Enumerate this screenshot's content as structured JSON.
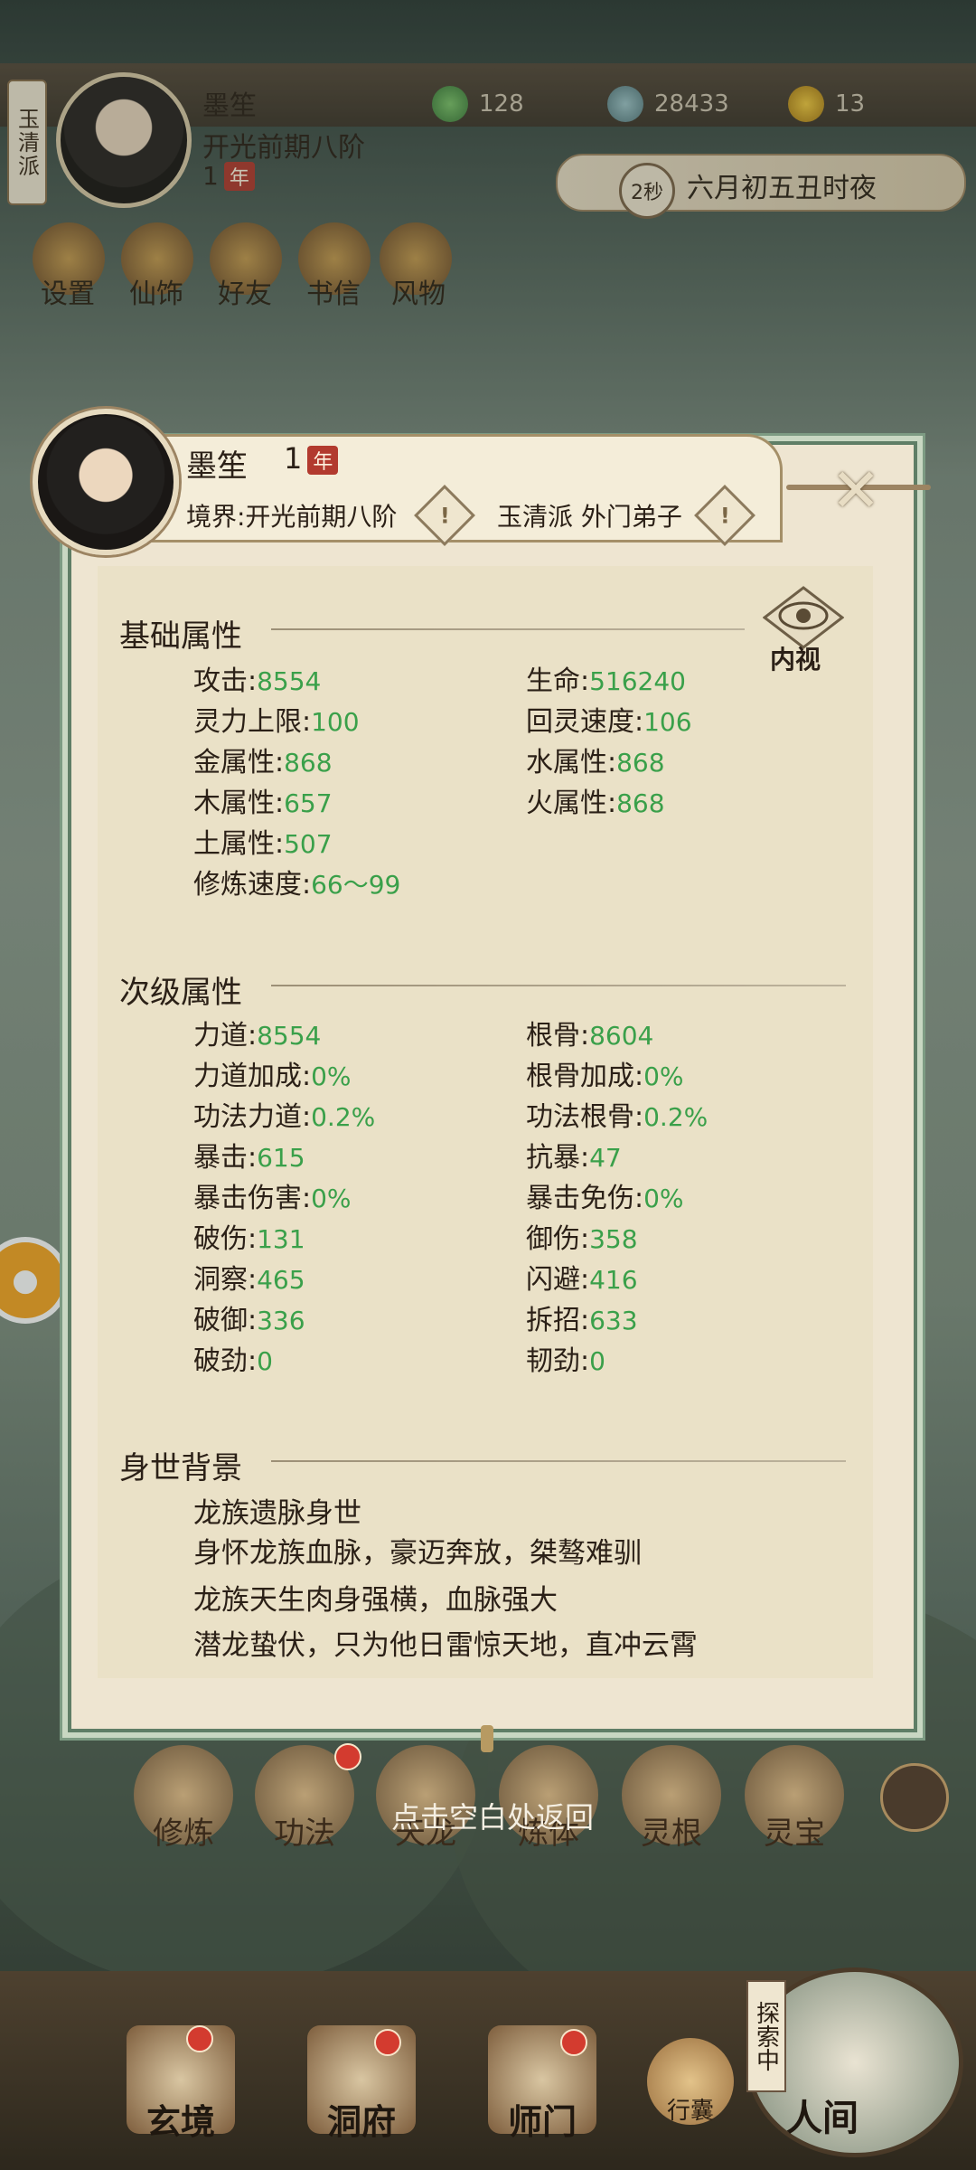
{
  "top": {
    "sect_tag": "玉清派",
    "player_name": "墨笙",
    "realm": "开光前期八阶",
    "age": "1",
    "age_badge": "年",
    "resources": [
      {
        "icon": "jade-leaf-icon",
        "value": "128"
      },
      {
        "icon": "coin-icon",
        "value": "28433"
      },
      {
        "icon": "gold-ingot-icon",
        "value": "13"
      }
    ],
    "time_seconds": "2秒",
    "time_text": "六月初五丑时夜",
    "menu": [
      {
        "label": "设置",
        "icon": "settings-icon"
      },
      {
        "label": "仙饰",
        "icon": "costume-icon"
      },
      {
        "label": "好友",
        "icon": "friends-icon"
      },
      {
        "label": "书信",
        "icon": "letter-icon"
      },
      {
        "label": "风物",
        "icon": "scenery-icon"
      }
    ]
  },
  "panel": {
    "name": "墨笙",
    "age": "1",
    "age_badge": "年",
    "realm_line": "境界:开光前期八阶",
    "sect_line": "玉清派 外门弟子",
    "inner_view_label": "内视",
    "basic": {
      "title": "基础属性",
      "left": [
        {
          "label": "攻击",
          "value": "8554"
        },
        {
          "label": "灵力上限",
          "value": "100"
        },
        {
          "label": "金属性",
          "value": "868"
        },
        {
          "label": "木属性",
          "value": "657"
        },
        {
          "label": "土属性",
          "value": "507"
        },
        {
          "label": "修炼速度",
          "value": "66～99"
        }
      ],
      "right": [
        {
          "label": "生命",
          "value": "516240"
        },
        {
          "label": "回灵速度",
          "value": "106"
        },
        {
          "label": "水属性",
          "value": "868"
        },
        {
          "label": "火属性",
          "value": "868"
        }
      ]
    },
    "secondary": {
      "title": "次级属性",
      "left": [
        {
          "label": "力道",
          "value": "8554"
        },
        {
          "label": "力道加成",
          "value": "0%"
        },
        {
          "label": "功法力道",
          "value": "0.2%"
        },
        {
          "label": "暴击",
          "value": "615"
        },
        {
          "label": "暴击伤害",
          "value": "0%"
        },
        {
          "label": "破伤",
          "value": "131"
        },
        {
          "label": "洞察",
          "value": "465"
        },
        {
          "label": "破御",
          "value": "336"
        },
        {
          "label": "破劲",
          "value": "0"
        }
      ],
      "right": [
        {
          "label": "根骨",
          "value": "8604"
        },
        {
          "label": "根骨加成",
          "value": "0%"
        },
        {
          "label": "功法根骨",
          "value": "0.2%"
        },
        {
          "label": "抗暴",
          "value": "47"
        },
        {
          "label": "暴击免伤",
          "value": "0%"
        },
        {
          "label": "御伤",
          "value": "358"
        },
        {
          "label": "闪避",
          "value": "416"
        },
        {
          "label": "拆招",
          "value": "633"
        },
        {
          "label": "韧劲",
          "value": "0"
        }
      ]
    },
    "background": {
      "title": "身世背景",
      "lines": [
        "龙族遗脉身世",
        "身怀龙族血脉，豪迈奔放，桀骜难驯",
        "龙族天生肉身强横，血脉强大",
        "潜龙蛰伏，只为他日雷惊天地，直冲云霄"
      ]
    }
  },
  "skills": [
    {
      "label": "修炼"
    },
    {
      "label": "功法"
    },
    {
      "label": "天龙"
    },
    {
      "label": "炼体"
    },
    {
      "label": "灵根"
    },
    {
      "label": "灵宝"
    }
  ],
  "return_hint": "点击空白处返回",
  "bottom_nav": [
    {
      "label": "玄境"
    },
    {
      "label": "洞府"
    },
    {
      "label": "师门"
    },
    {
      "label": "行囊"
    },
    {
      "label": "人间"
    }
  ],
  "exploring_label": "探索中",
  "colors": {
    "stat_value": "#3aa04a",
    "accent_red": "#b23a2e",
    "panel_border": "#5f7e66"
  }
}
